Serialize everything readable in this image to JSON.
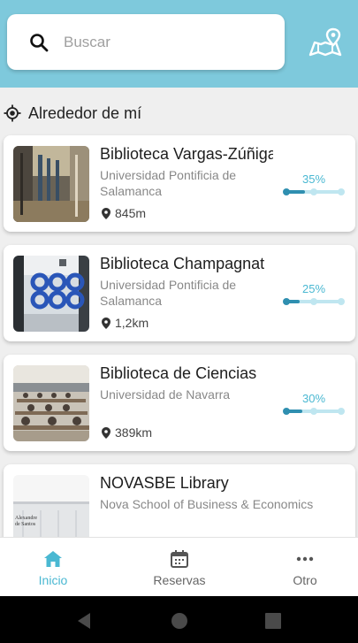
{
  "colors": {
    "accent": "#4ab8d2",
    "header": "#7ec9dc",
    "bar_fill": "#2f8fb0",
    "bar_track": "#bfe6f0"
  },
  "search": {
    "placeholder": "Buscar",
    "icon": "search-icon"
  },
  "map_button": {
    "icon": "map-location-icon"
  },
  "nearby": {
    "label": "Alrededor de mí",
    "icon": "location-target-icon"
  },
  "libraries": [
    {
      "name": "Biblioteca Vargas-Zúñiga",
      "university": "Universidad Pontificia de Salamanca",
      "distance": "845m",
      "occupancy_label": "35%",
      "occupancy": 0.35
    },
    {
      "name": "Biblioteca Champagnat",
      "university": "Universidad Pontificia de Salamanca",
      "distance": "1,2km",
      "occupancy_label": "25%",
      "occupancy": 0.25
    },
    {
      "name": "Biblioteca de Ciencias",
      "university": "Universidad de Navarra",
      "distance": "389km",
      "occupancy_label": "30%",
      "occupancy": 0.3
    },
    {
      "name": "NOVASBE Library",
      "university": "Nova School of Business & Economics",
      "thumb_text": "Alexandre\nde Santos"
    }
  ],
  "tabs": [
    {
      "label": "Inicio",
      "icon": "home-icon",
      "active": true
    },
    {
      "label": "Reservas",
      "icon": "calendar-icon",
      "active": false
    },
    {
      "label": "Otro",
      "icon": "more-dots-icon",
      "active": false
    }
  ],
  "system_nav": [
    "back-icon",
    "home-circle-icon",
    "recents-icon"
  ]
}
